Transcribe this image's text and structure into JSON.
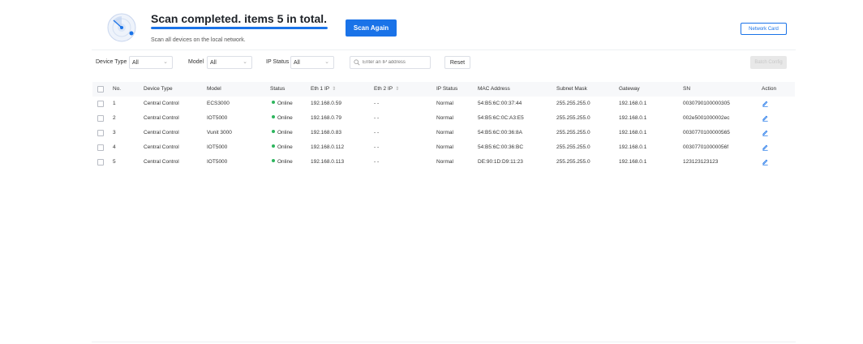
{
  "scan": {
    "title": "Scan completed. items 5 in total.",
    "subtitle": "Scan all devices on the local network.",
    "progress": 1.0,
    "scan_again_label": "Scan Again",
    "network_card_label": "Network Card"
  },
  "filters": {
    "device_type_label": "Device Type",
    "device_type_value": "All",
    "model_label": "Model",
    "model_value": "All",
    "ip_status_label": "IP Status",
    "ip_status_value": "All",
    "search_placeholder": "Enter an IP address",
    "reset_label": "Reset",
    "batch_label": "Batch Config"
  },
  "table": {
    "columns": [
      "No.",
      "Device Type",
      "Model",
      "Status",
      "Eth 1 IP",
      "Eth 2 IP",
      "IP Status",
      "MAC Address",
      "Subnet Mask",
      "Gateway",
      "SN",
      "Action"
    ],
    "rows": [
      {
        "no": "1",
        "device_type": "Central Control",
        "model": "ECS3000",
        "status": "Online",
        "eth1": "192.168.0.59",
        "eth2": "- -",
        "ip_status": "Normal",
        "mac": "54:B5:6C:00:37:44",
        "mask": "255.255.255.0",
        "gateway": "192.168.0.1",
        "sn": "0030790100000305"
      },
      {
        "no": "2",
        "device_type": "Central Control",
        "model": "IOT5000",
        "status": "Online",
        "eth1": "192.168.0.79",
        "eth2": "- -",
        "ip_status": "Normal",
        "mac": "54:B5:6C:0C:A3:E5",
        "mask": "255.255.255.0",
        "gateway": "192.168.0.1",
        "sn": "002e5001000002ec"
      },
      {
        "no": "3",
        "device_type": "Central Control",
        "model": "Vunit 3000",
        "status": "Online",
        "eth1": "192.168.0.83",
        "eth2": "- -",
        "ip_status": "Normal",
        "mac": "54:B5:6C:00:36:8A",
        "mask": "255.255.255.0",
        "gateway": "192.168.0.1",
        "sn": "0030770100000565"
      },
      {
        "no": "4",
        "device_type": "Central Control",
        "model": "IOT5000",
        "status": "Online",
        "eth1": "192.168.0.112",
        "eth2": "- -",
        "ip_status": "Normal",
        "mac": "54:B5:6C:00:36:BC",
        "mask": "255.255.255.0",
        "gateway": "192.168.0.1",
        "sn": "003077010000056f"
      },
      {
        "no": "5",
        "device_type": "Central Control",
        "model": "IOT5000",
        "status": "Online",
        "eth1": "192.168.0.113",
        "eth2": "- -",
        "ip_status": "Normal",
        "mac": "DE:90:1D:D9:11:23",
        "mask": "255.255.255.0",
        "gateway": "192.168.0.1",
        "sn": "123123123123"
      }
    ]
  },
  "colors": {
    "primary": "#1a73e8",
    "online": "#2db55d"
  },
  "icons": {
    "radar": "radar-scan-icon",
    "search": "search-icon",
    "edit": "edit-icon",
    "chevron": "chevron-down-icon"
  }
}
